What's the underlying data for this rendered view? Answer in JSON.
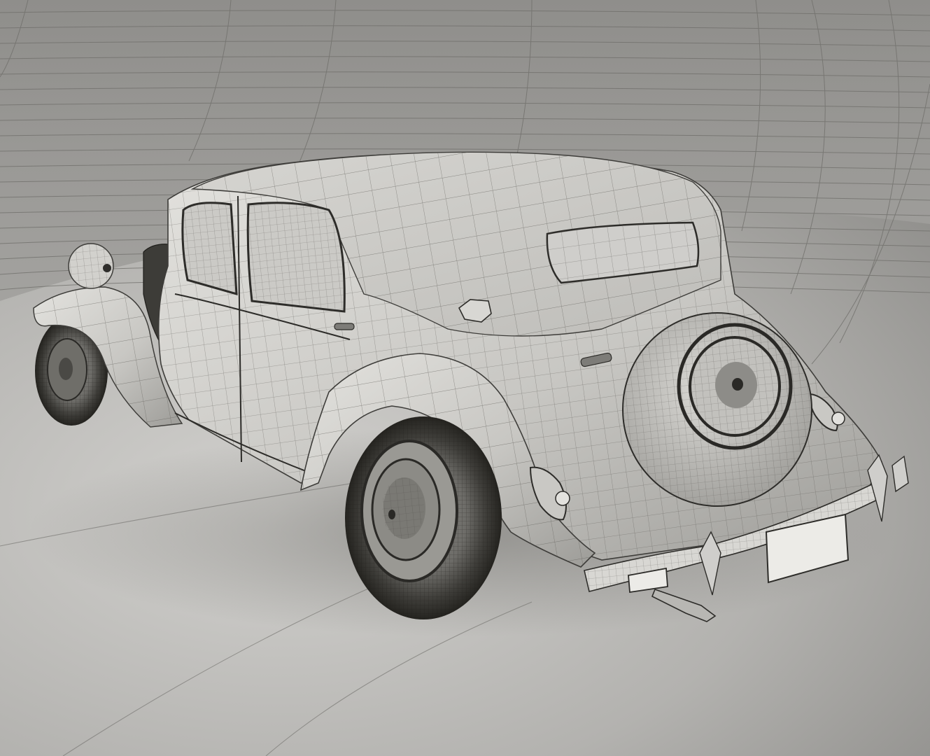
{
  "scene": {
    "subject": "vintage-sedan-wireframe-render",
    "view": "rear-three-quarter",
    "palette": {
      "backdrop": "#9a9996",
      "floor_light": "#c4c3c0",
      "floor_dark": "#9e9d9a",
      "body_light": "#d9d8d4",
      "body_mid": "#bdbcb8",
      "body_dark": "#8e8d8a",
      "tire": "#55544f",
      "tire_dark": "#2f2e2b",
      "wire": "#3c3b38"
    },
    "labels": []
  }
}
